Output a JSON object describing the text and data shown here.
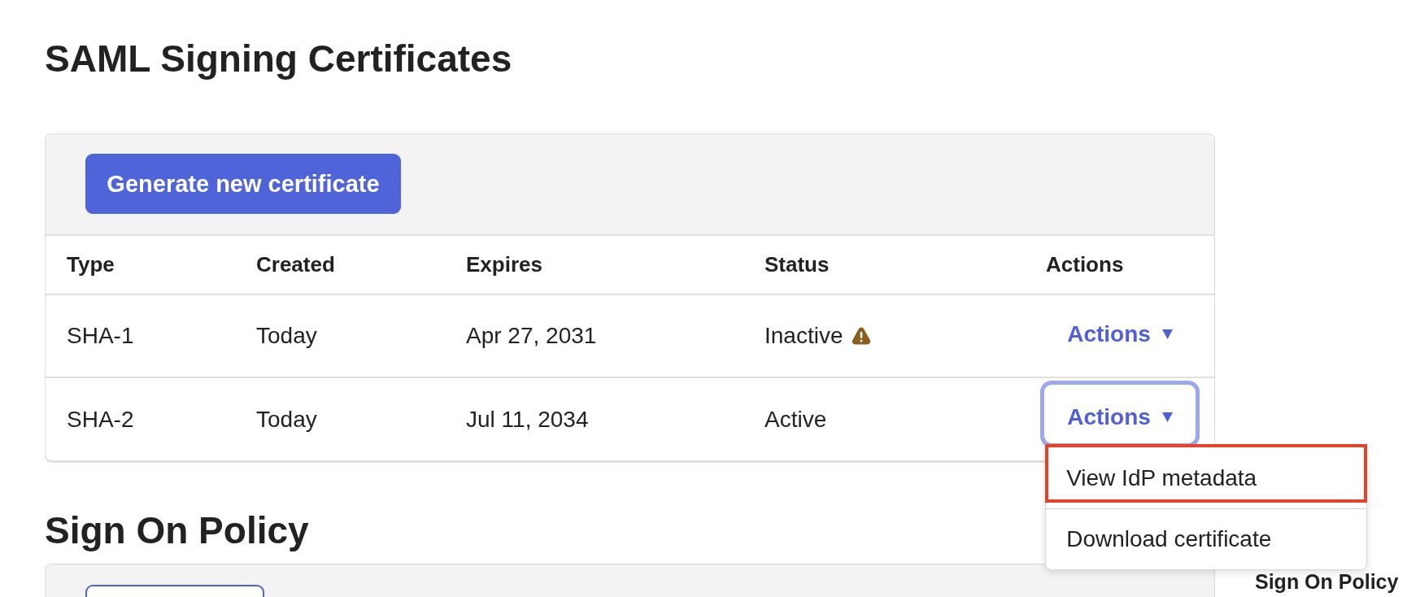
{
  "saml_certificates": {
    "title": "SAML Signing Certificates",
    "generate_button": "Generate new certificate",
    "table": {
      "columns": [
        "Type",
        "Created",
        "Expires",
        "Status",
        "Actions"
      ],
      "rows": [
        {
          "type": "SHA-1",
          "created": "Today",
          "expires": "Apr 27, 2031",
          "status": "Inactive",
          "warning": true,
          "actions": {
            "label": "Actions",
            "expanded": false
          }
        },
        {
          "type": "SHA-2",
          "created": "Today",
          "expires": "Jul 11, 2034",
          "status": "Active",
          "warning": false,
          "actions": {
            "label": "Actions",
            "expanded": true,
            "menu": [
              {
                "label": "View IdP metadata",
                "highlighted": true
              },
              {
                "label": "Download certificate",
                "highlighted": false
              }
            ]
          }
        }
      ]
    }
  },
  "sign_on_policy": {
    "title": "Sign On Policy"
  },
  "sidebar": {
    "items": [
      {
        "label": "Sign On Policy"
      }
    ]
  }
}
